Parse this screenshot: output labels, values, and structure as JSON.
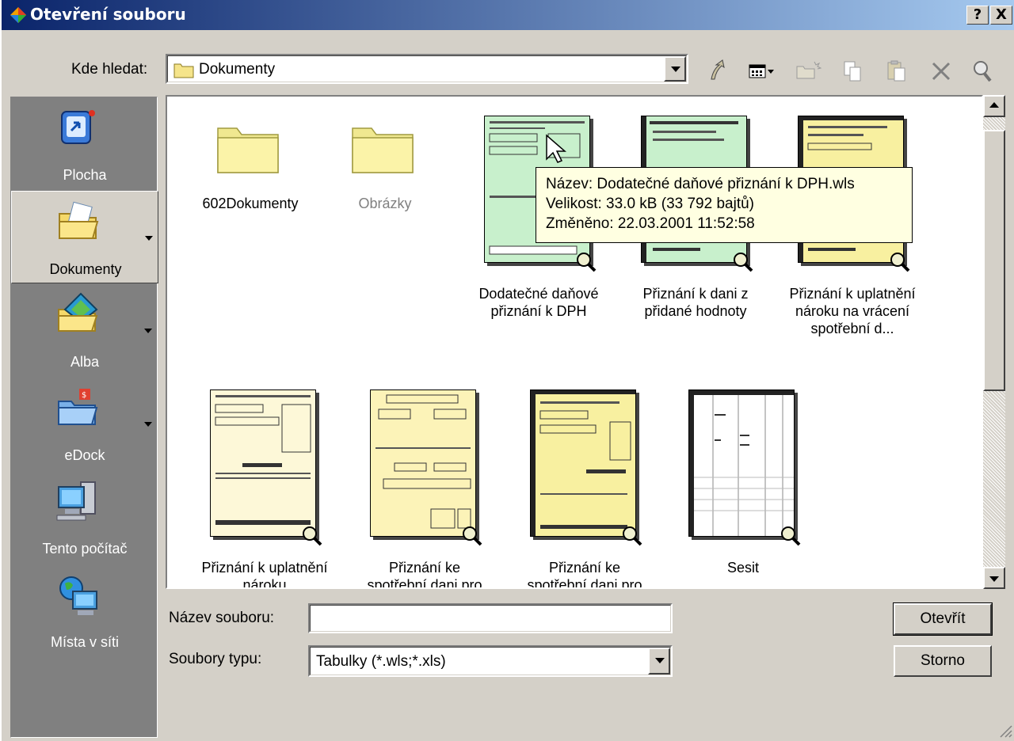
{
  "window": {
    "title": "Otevření souboru",
    "help_label": "?",
    "close_label": "X"
  },
  "lookin": {
    "label": "Kde hledat:",
    "value": "Dokumenty"
  },
  "toolbar": {
    "icons": [
      "up-one-level-icon",
      "view-menu-icon",
      "new-folder-icon",
      "copy-icon",
      "paste-icon",
      "delete-icon",
      "search-icon"
    ]
  },
  "places": [
    {
      "label": "Plocha",
      "icon": "desktop-icon"
    },
    {
      "label": "Dokumenty",
      "icon": "documents-icon"
    },
    {
      "label": "Alba",
      "icon": "albums-icon"
    },
    {
      "label": "eDock",
      "icon": "edock-icon"
    },
    {
      "label": "Tento počítač",
      "icon": "computer-icon"
    },
    {
      "label": "Místa v síti",
      "icon": "network-icon"
    }
  ],
  "files": [
    {
      "name": "602Dokumenty",
      "type": "folder"
    },
    {
      "name": "Obrázky",
      "type": "folder"
    },
    {
      "name": "Dodatečné daňové přiznání k DPH",
      "type": "form-green"
    },
    {
      "name": "Přiznání k dani z přidané hodnoty",
      "type": "form-green"
    },
    {
      "name": "Přiznání k uplatnění nároku na vrácení spotřební d...",
      "type": "form-yellow"
    },
    {
      "name": "Přiznání k uplatnění nároku",
      "type": "form-cream"
    },
    {
      "name": "Přiznání ke spotřební dani pro",
      "type": "form-cream"
    },
    {
      "name": "Přiznání ke spotřební dani pro",
      "type": "form-yellow"
    },
    {
      "name": "Sesit",
      "type": "sheet"
    }
  ],
  "tooltip": {
    "line1": "Název: Dodatečné daňové přiznání k DPH.wls",
    "line2": "Velikost: 33.0 kB (33 792 bajtů)",
    "line3": "Změněno: 22.03.2001 11:52:58"
  },
  "filename": {
    "label": "Název souboru:",
    "value": ""
  },
  "filetype": {
    "label": "Soubory typu:",
    "value": "Tabulky (*.wls;*.xls)"
  },
  "buttons": {
    "open": "Otevřít",
    "cancel": "Storno"
  }
}
